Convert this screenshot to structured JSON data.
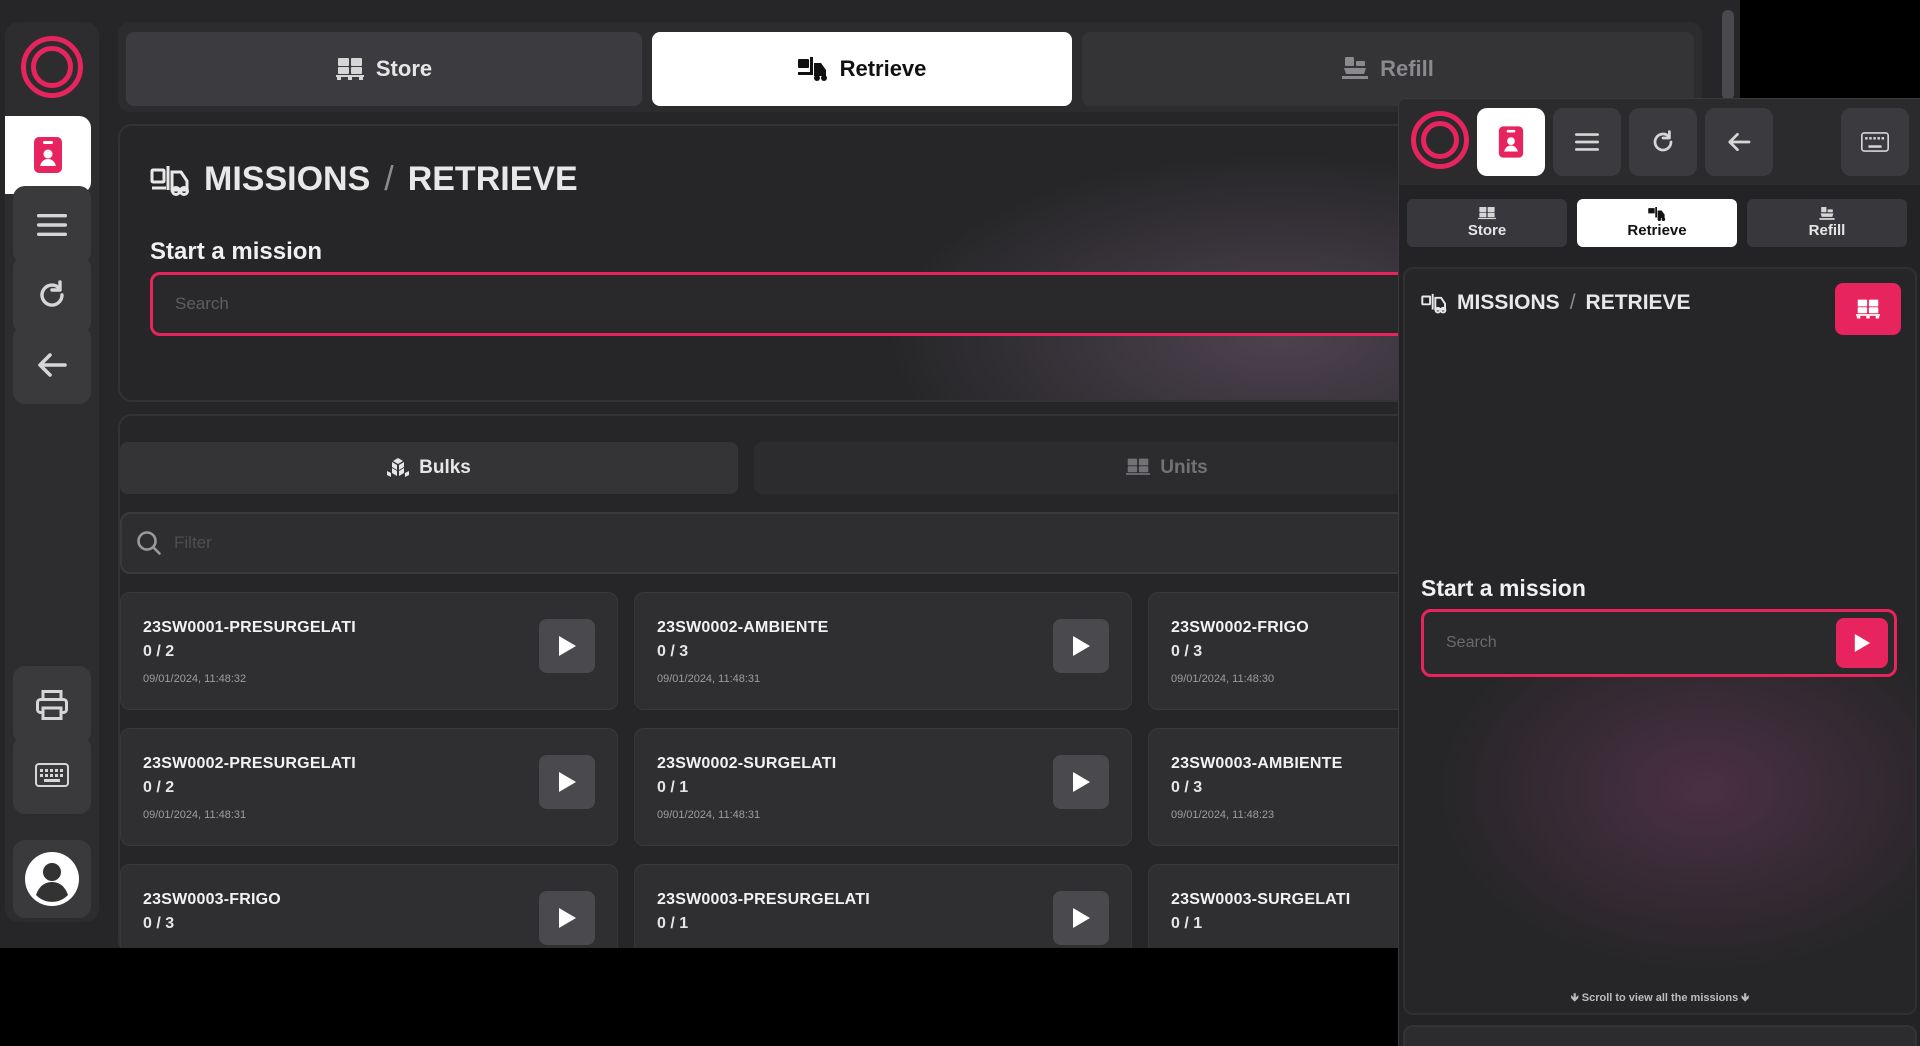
{
  "desktop": {
    "tabs": [
      {
        "label": "Store",
        "icon": "pallet-icon"
      },
      {
        "label": "Retrieve",
        "icon": "forklift-icon"
      },
      {
        "label": "Refill",
        "icon": "refill-icon"
      }
    ],
    "breadcrumb": {
      "root": "MISSIONS",
      "separator": "/",
      "current": "RETRIEVE"
    },
    "start_mission_label": "Start a mission",
    "search_placeholder": "Search",
    "subtabs": [
      {
        "label": "Bulks",
        "icon": "boxes-icon"
      },
      {
        "label": "Units",
        "icon": "pallet-icon"
      }
    ],
    "filter_placeholder": "Filter",
    "missions": [
      {
        "name": "23SW0001-PRESURGELATI",
        "count": "0 / 2",
        "date": "09/01/2024, 11:48:32"
      },
      {
        "name": "23SW0002-AMBIENTE",
        "count": "0 / 3",
        "date": "09/01/2024, 11:48:31"
      },
      {
        "name": "23SW0002-FRIGO",
        "count": "0 / 3",
        "date": "09/01/2024, 11:48:30"
      },
      {
        "name": "23SW0002-PRESURGELATI",
        "count": "0 / 2",
        "date": "09/01/2024, 11:48:31"
      },
      {
        "name": "23SW0002-SURGELATI",
        "count": "0 / 1",
        "date": "09/01/2024, 11:48:31"
      },
      {
        "name": "23SW0003-AMBIENTE",
        "count": "0 / 3",
        "date": "09/01/2024, 11:48:23"
      },
      {
        "name": "23SW0003-FRIGO",
        "count": "0 / 3",
        "date": ""
      },
      {
        "name": "23SW0003-PRESURGELATI",
        "count": "0 / 1",
        "date": ""
      },
      {
        "name": "23SW0003-SURGELATI",
        "count": "0 / 1",
        "date": ""
      }
    ]
  },
  "mobile": {
    "tabs": [
      {
        "label": "Store"
      },
      {
        "label": "Retrieve"
      },
      {
        "label": "Refill"
      }
    ],
    "breadcrumb": {
      "root": "MISSIONS",
      "separator": "/",
      "current": "RETRIEVE"
    },
    "start_mission_label": "Start a mission",
    "search_placeholder": "Search",
    "scroll_hint": "🡻 Scroll to view all the missions 🡻"
  },
  "colors": {
    "accent": "#e8245e",
    "background": "#262628"
  }
}
